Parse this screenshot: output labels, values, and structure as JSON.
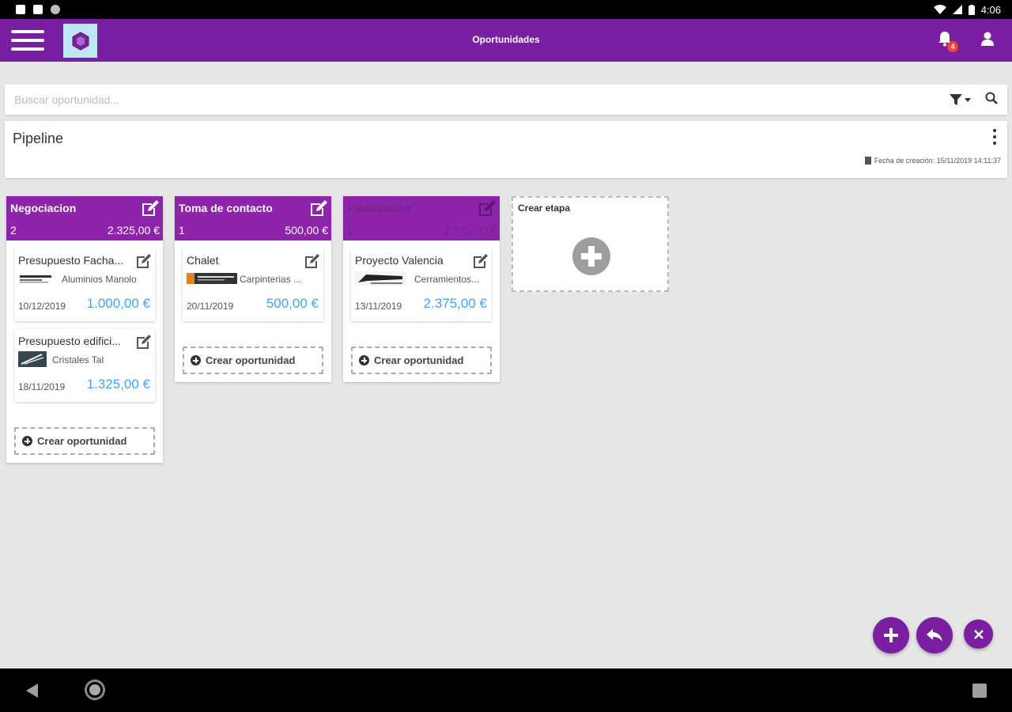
{
  "status_bar": {
    "time": "4:06"
  },
  "app_bar": {
    "title": "Oportunidades",
    "notification_count": "4"
  },
  "search": {
    "placeholder": "Buscar oportunidad..."
  },
  "pipeline": {
    "title": "Pipeline",
    "creation_date": "Fecha de creación: 15/11/2019 14:11:37"
  },
  "stages": [
    {
      "name": "Negociacion",
      "count": "2",
      "total": "2.325,00 €",
      "opportunities": [
        {
          "title": "Presupuesto Facha...",
          "company": "Aluminios Manolo",
          "date": "10/12/2019",
          "amount": "1.000,00 €"
        },
        {
          "title": "Presupuesto edifici...",
          "company": "Cristales Tal",
          "date": "18/11/2019",
          "amount": "1.325,00 €"
        }
      ]
    },
    {
      "name": "Toma de contacto",
      "count": "1",
      "total": "500,00 €",
      "opportunities": [
        {
          "title": "Chalet",
          "company": "Carpinterias ...",
          "date": "20/11/2019",
          "amount": "500,00 €"
        }
      ]
    },
    {
      "name": "Finalización",
      "count": "1",
      "total": "2.375,00 €",
      "opportunities": [
        {
          "title": "Proyecto Valencia",
          "company": "Cerramientos...",
          "date": "13/11/2019",
          "amount": "2.375,00 €"
        }
      ]
    }
  ],
  "create_opportunity_label": "Crear oportunidad",
  "create_stage_label": "Crear etapa",
  "colors": {
    "primary": "#7b1fa2",
    "stage_header": "#8e24aa",
    "amount": "#42a5f5",
    "background": "#e6e6e6"
  }
}
